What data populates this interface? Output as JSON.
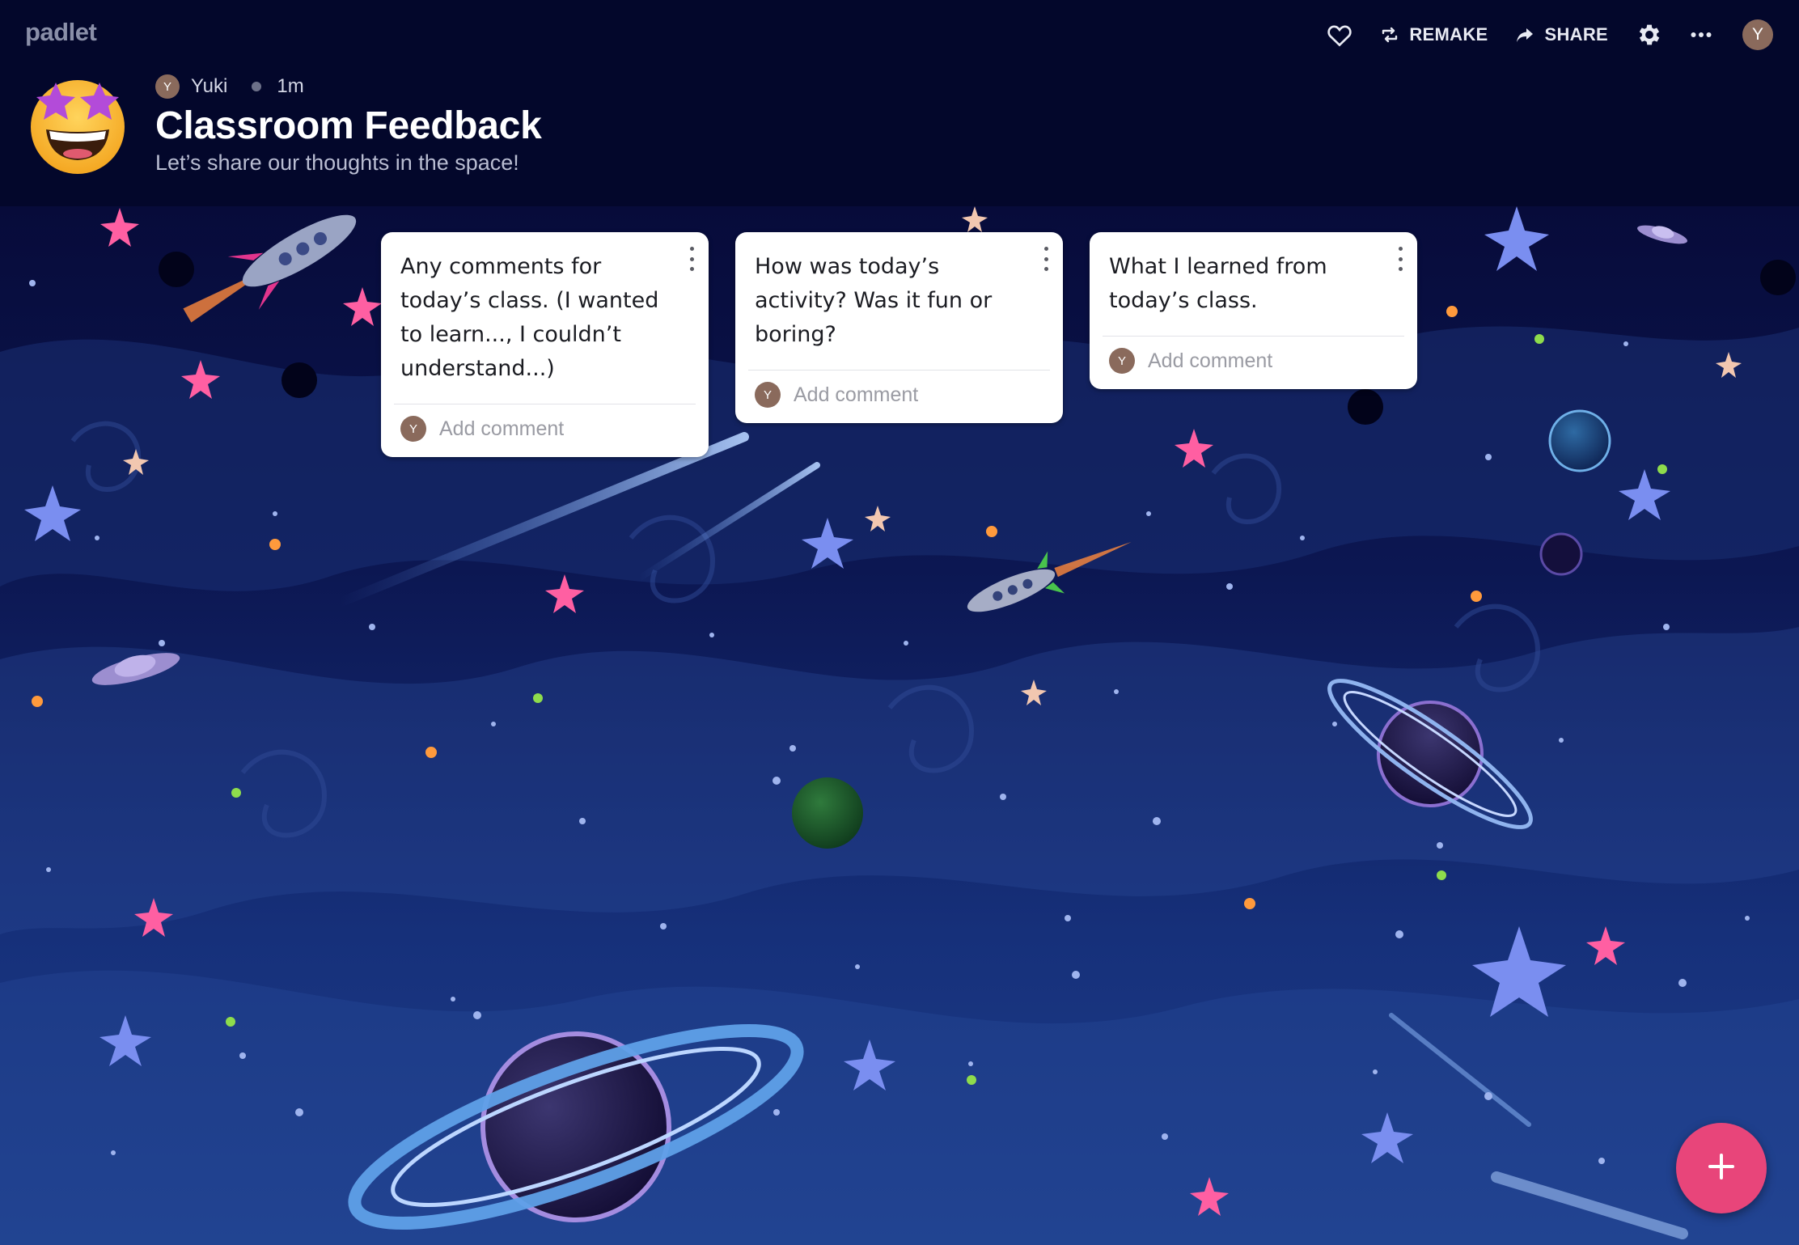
{
  "app": {
    "brand": "padlet"
  },
  "toolbar": {
    "like_icon": "heart-icon",
    "remake_label": "REMAKE",
    "share_label": "SHARE",
    "settings_icon": "gear-icon",
    "more_icon": "ellipsis-icon",
    "avatar_initial": "Y"
  },
  "board": {
    "emoji": "star-struck-emoji",
    "author_initial": "Y",
    "author": "Yuki",
    "time": "1m",
    "title": "Classroom Feedback",
    "subtitle": "Let’s share our thoughts in the space!",
    "background": "space-wallpaper"
  },
  "cards": [
    {
      "text": "Any comments for today’s class. (I wanted to learn..., I couldn’t understand...)",
      "comment_placeholder": "Add comment",
      "avatar_initial": "Y"
    },
    {
      "text": "How was today’s activity? Was it fun or boring?",
      "comment_placeholder": "Add comment",
      "avatar_initial": "Y"
    },
    {
      "text": "What I learned from today’s class.",
      "comment_placeholder": "Add comment",
      "avatar_initial": "Y"
    }
  ],
  "fab": {
    "icon": "plus-icon"
  },
  "colors": {
    "header_bg": "#03072b",
    "fab": "#e8457a",
    "avatar": "#8a6a5c"
  }
}
